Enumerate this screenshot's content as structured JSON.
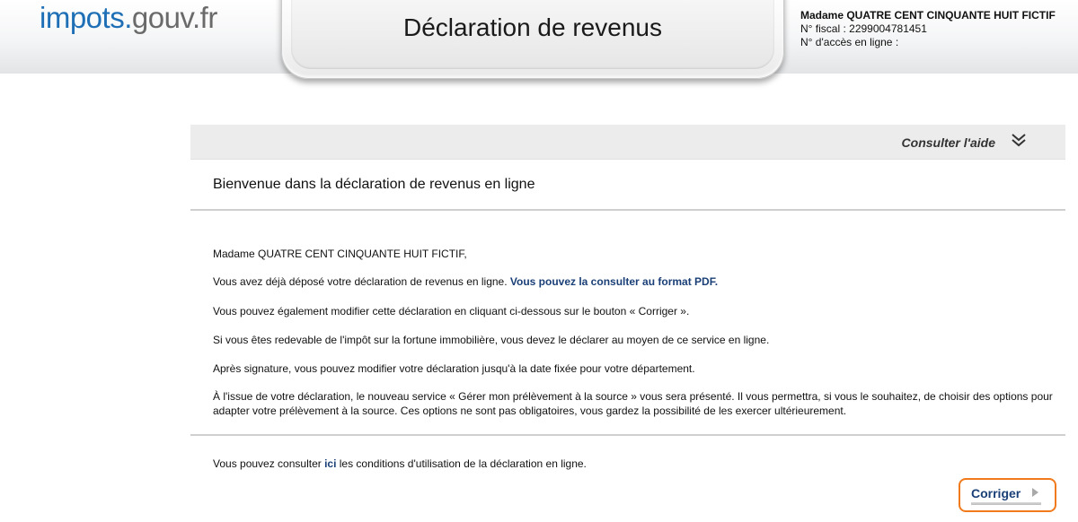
{
  "header": {
    "logo_part1": "impots",
    "logo_dot": ".",
    "logo_part2": "gouv.fr",
    "title": "Déclaration de revenus",
    "user_name": "Madame QUATRE CENT CINQUANTE HUIT FICTIF",
    "fiscal_number": "N° fiscal : 2299004781451",
    "access_number": "N° d'accès en ligne :"
  },
  "help": {
    "label": "Consulter l'aide",
    "icon": "double-chevron-down-icon"
  },
  "main": {
    "welcome_title": "Bienvenue dans la déclaration de revenus en ligne",
    "greeting": "Madame QUATRE CENT CINQUANTE HUIT FICTIF,",
    "p1_text": "Vous avez déjà déposé votre déclaration de revenus en ligne. ",
    "p1_link": "Vous pouvez la consulter au format PDF",
    "p1_end": ".",
    "p2": "Vous pouvez également modifier cette déclaration en cliquant ci-dessous sur le bouton « Corriger ».",
    "p3": "Si vous êtes redevable de l'impôt sur la fortune immobilière, vous devez le déclarer au moyen de ce service en ligne.",
    "p4": "Après signature, vous pouvez modifier votre déclaration jusqu'à la date fixée pour votre département.",
    "p5": "À l'issue de votre déclaration, le nouveau service « Gérer mon prélèvement à la source » vous sera présenté. Il vous permettra, si vous le souhaitez, de choisir des options pour adapter votre prélèvement à la source. Ces options ne sont pas obligatoires, vous gardez la possibilité de les exercer ultérieurement.",
    "conditions_before": "Vous pouvez consulter ",
    "conditions_link": "ici",
    "conditions_after": " les conditions d'utilisation de la déclaration en ligne."
  },
  "actions": {
    "corriger_label": "Corriger"
  },
  "colors": {
    "accent_blue": "#1a3f77",
    "highlight_orange": "#f07a1c"
  }
}
